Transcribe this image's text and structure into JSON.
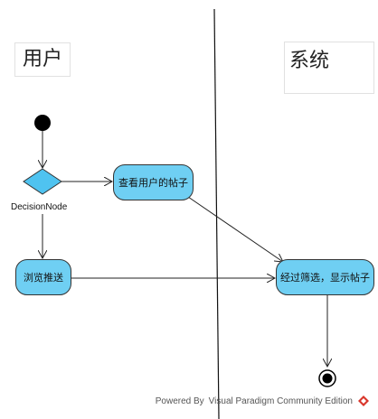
{
  "swimlanes": [
    {
      "id": "user",
      "label": "用户"
    },
    {
      "id": "system",
      "label": "系统"
    }
  ],
  "nodes": {
    "decision": {
      "label": "DecisionNode"
    },
    "view_posts": {
      "label": "查看用户的帖子"
    },
    "browse_feed": {
      "label": "浏览推送"
    },
    "filter_show": {
      "label": "经过筛选，显示帖子"
    }
  },
  "footer": {
    "text": "Powered By Visual Paradigm Community Edition"
  },
  "colors": {
    "action_fill": "#6fcff3",
    "decision_fill": "#4fc3f0",
    "logo": "#d9362b"
  }
}
